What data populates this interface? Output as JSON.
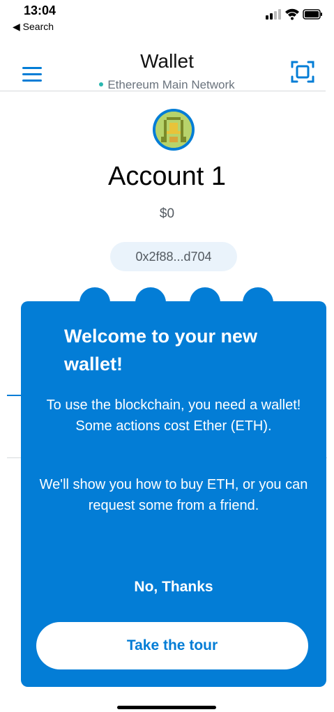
{
  "status_bar": {
    "time": "13:04",
    "back_label": "◀ Search"
  },
  "header": {
    "title": "Wallet",
    "network": "Ethereum Main Network",
    "network_status_color": "#29b6af"
  },
  "account": {
    "name": "Account 1",
    "balance": "$0",
    "address": "0x2f88...d704"
  },
  "modal": {
    "title": "Welcome to your new wallet!",
    "paragraph_1": "To use the blockchain, you need a wallet! Some actions cost Ether (ETH).",
    "paragraph_2": "We'll show you how to buy ETH, or you can request some from a friend.",
    "dismiss_label": "No, Thanks",
    "primary_label": "Take the tour"
  },
  "colors": {
    "accent": "#037dd6",
    "background": "#ffffff",
    "modal_background": "#037dd6"
  },
  "icons": {
    "menu": "hamburger-icon",
    "scan": "qr-scan-icon",
    "avatar": "identicon"
  }
}
